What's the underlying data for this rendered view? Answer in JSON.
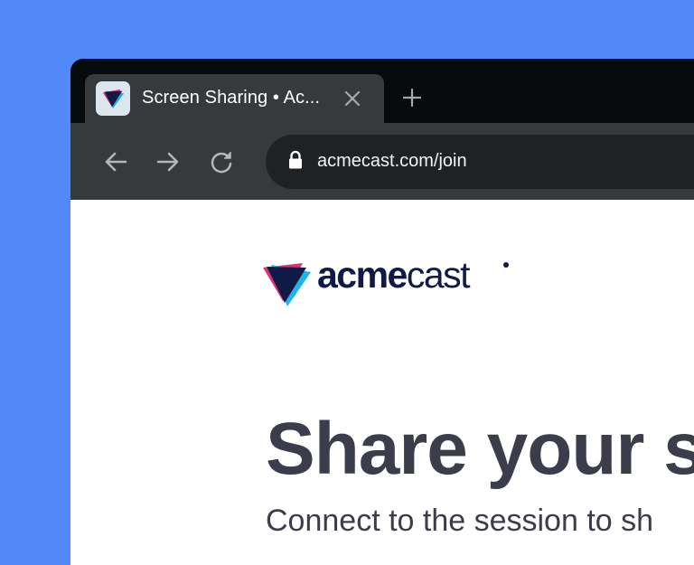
{
  "tab": {
    "title": "Screen Sharing • Ac...",
    "favicon": "acmecast-logo-icon",
    "close_icon": "close-icon"
  },
  "new_tab_icon": "plus-icon",
  "toolbar": {
    "back_icon": "arrow-left-icon",
    "forward_icon": "arrow-right-icon",
    "reload_icon": "reload-icon",
    "lock_icon": "lock-icon",
    "url": "acmecast.com/join"
  },
  "page": {
    "logo": {
      "bold_part": "acme",
      "light_part": "cast"
    },
    "headline": "Share your s",
    "subline": "Connect to the session to sh"
  },
  "colors": {
    "background": "#5288f8",
    "brand_navy": "#101a46",
    "brand_pink": "#e0307a",
    "brand_cyan": "#1eb4e6",
    "heading_text": "#3c3d4b"
  }
}
